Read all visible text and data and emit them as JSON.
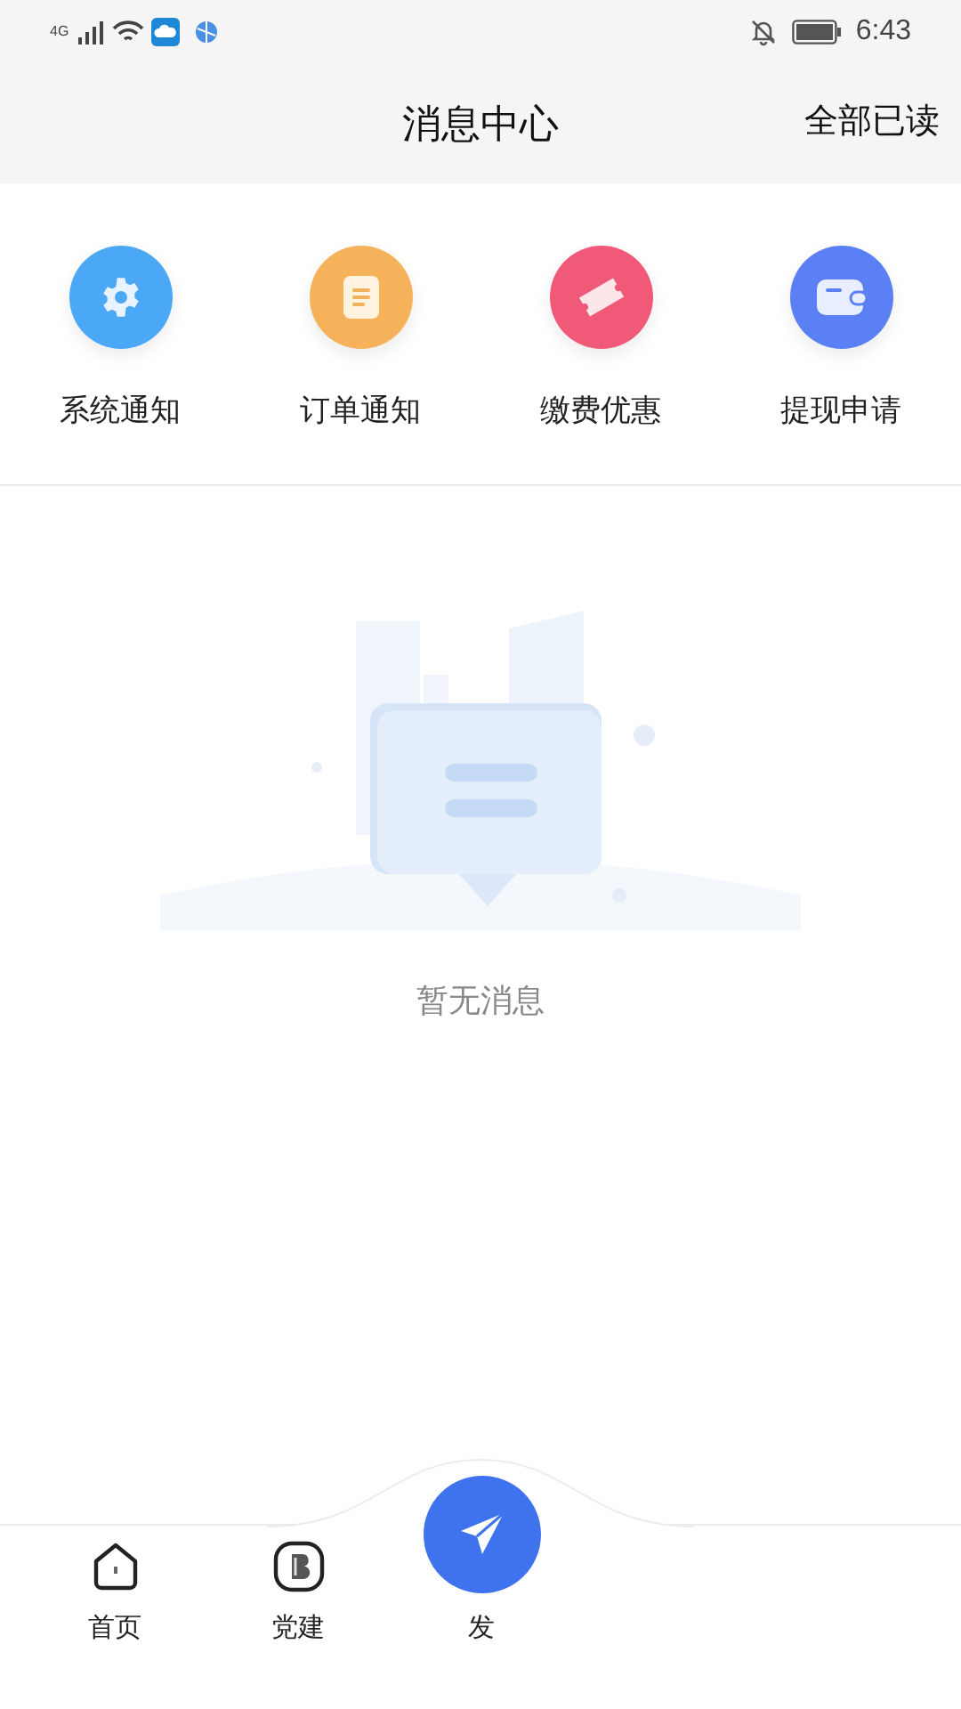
{
  "status_bar": {
    "network": "4G",
    "time": "6:43"
  },
  "header": {
    "title": "消息中心",
    "action": "全部已读"
  },
  "categories": [
    {
      "label": "系统通知",
      "kind": "settings",
      "color": "#4aa8f7"
    },
    {
      "label": "订单通知",
      "kind": "document",
      "color": "#f6b25a"
    },
    {
      "label": "缴费优惠",
      "kind": "ticket",
      "color": "#f05a78"
    },
    {
      "label": "提现申请",
      "kind": "wallet",
      "color": "#5b7ff5"
    }
  ],
  "empty_state": {
    "text": "暂无消息"
  },
  "bottom_nav": [
    {
      "label": "首页",
      "kind": "home"
    },
    {
      "label": "党建",
      "kind": "party"
    },
    {
      "label": "发",
      "kind": "publish"
    }
  ]
}
